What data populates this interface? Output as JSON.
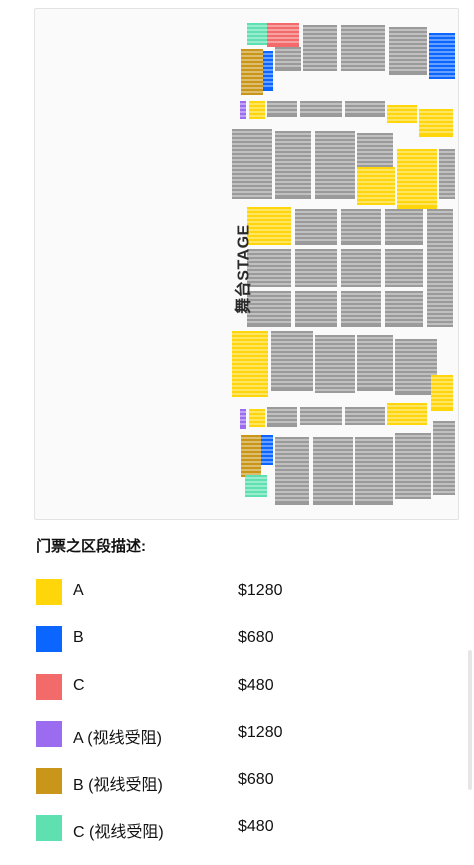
{
  "stage_label": "舞台STAGE",
  "legend_title": "门票之区段描述:",
  "legend": [
    {
      "zone": "A",
      "price": "$1280",
      "color": "#FFD60A"
    },
    {
      "zone": "B",
      "price": "$680",
      "color": "#0A66FF"
    },
    {
      "zone": "C",
      "price": "$480",
      "color": "#F26A6A"
    },
    {
      "zone": "A (视线受阻)",
      "price": "$1280",
      "color": "#9B6CF0"
    },
    {
      "zone": "B (视线受阻)",
      "price": "$680",
      "color": "#C9961A"
    },
    {
      "zone": "C (视线受阻)",
      "price": "$480",
      "color": "#5EE0B0"
    }
  ],
  "seat_colors": {
    "unavailable": "#9a9a9a",
    "walkway": "#ffffff"
  }
}
